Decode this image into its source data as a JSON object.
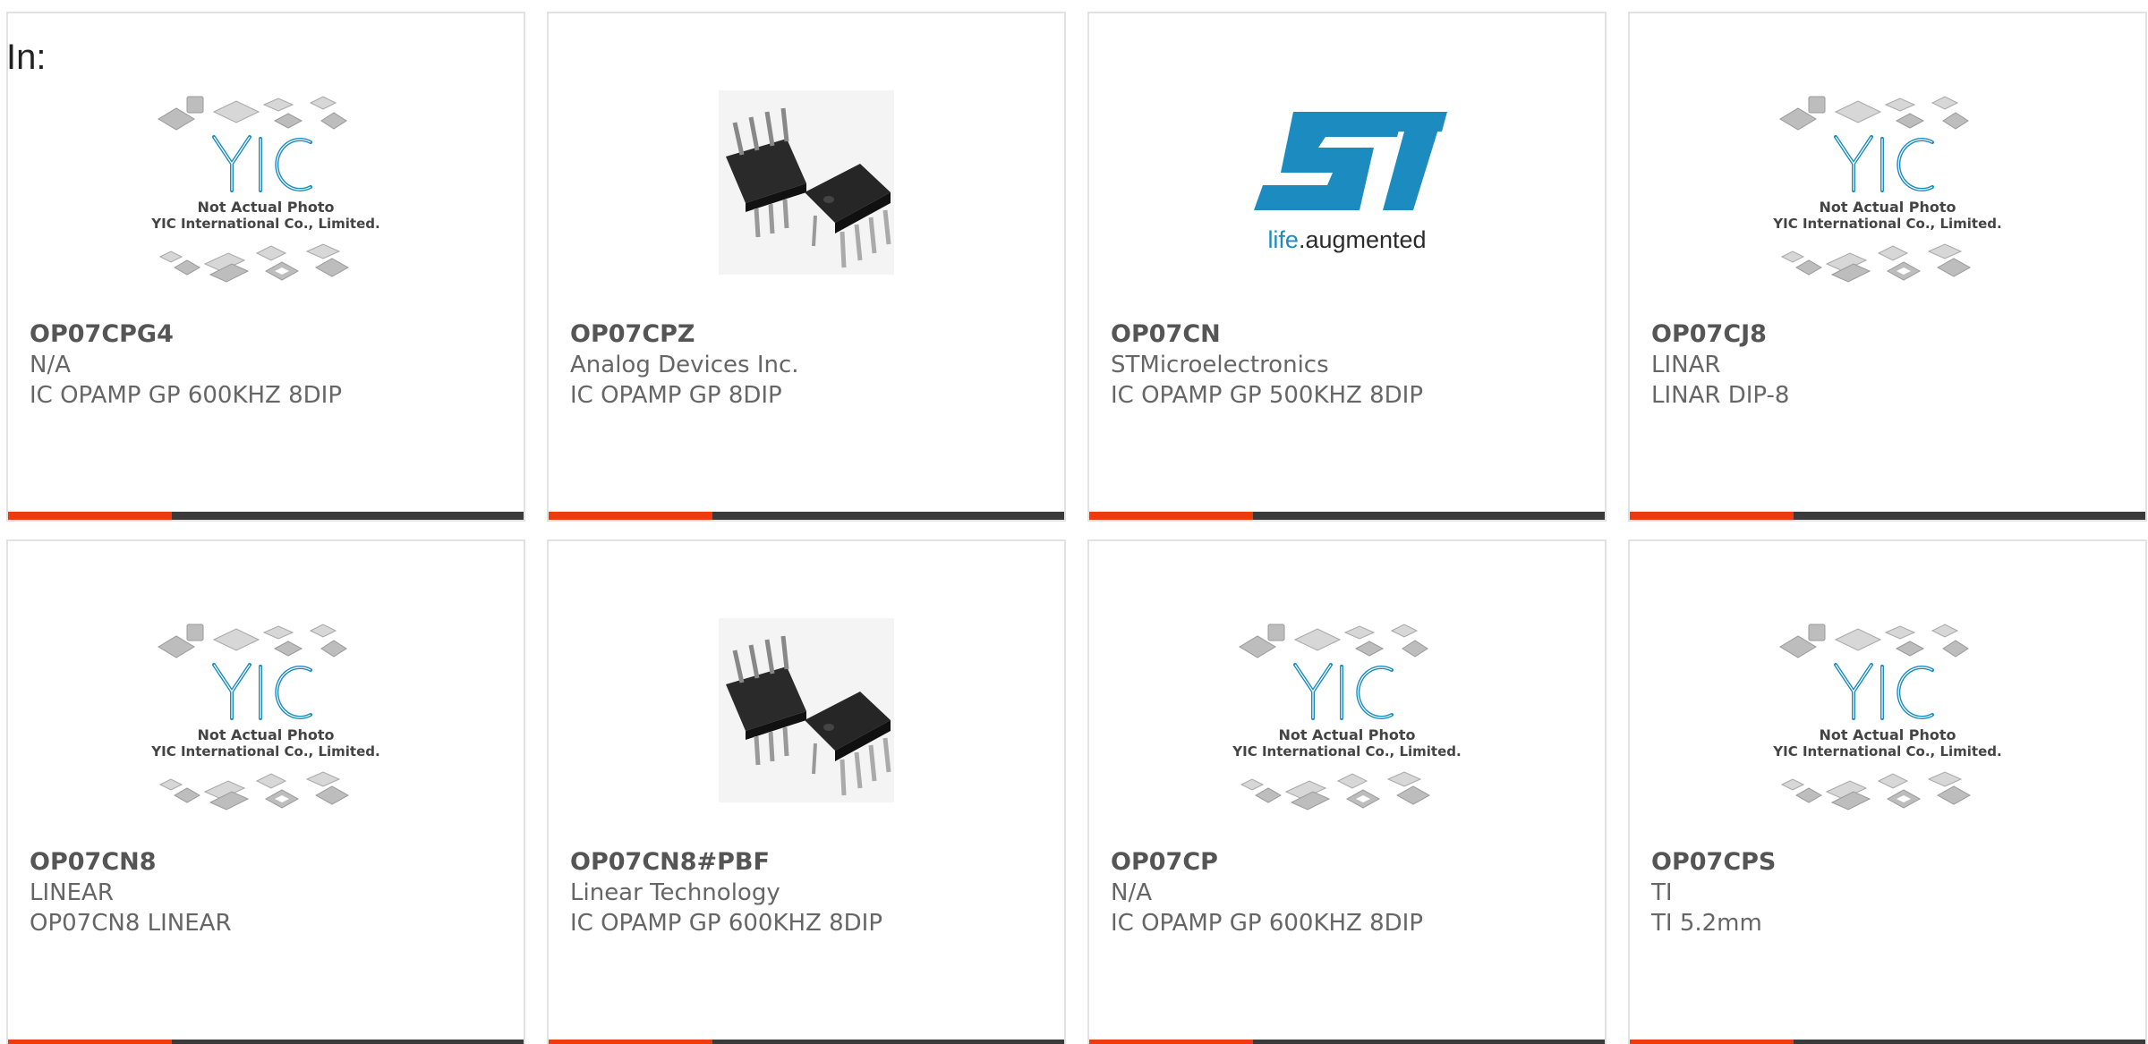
{
  "header": {
    "label": "In:"
  },
  "brand": {
    "yic_logo_text": "YIC",
    "placeholder_line1": "Not Actual Photo",
    "placeholder_line2": "YIC International Co., Limited.",
    "st_logo_text": "ST",
    "st_tagline_part1": "life",
    "st_tagline_part2": ".augmented",
    "accent_color": "#ee3a0f",
    "bar_color": "#3a3a3a",
    "st_blue": "#1c8cc0"
  },
  "products": [
    {
      "part": "OP07CPG4",
      "manufacturer": "N/A",
      "description": "IC OPAMP GP 600KHZ 8DIP",
      "image": "yic-placeholder"
    },
    {
      "part": "OP07CPZ",
      "manufacturer": "Analog Devices Inc.",
      "description": "IC OPAMP GP 8DIP",
      "image": "dip8-chip-photo"
    },
    {
      "part": "OP07CN",
      "manufacturer": "STMicroelectronics",
      "description": "IC OPAMP GP 500KHZ 8DIP",
      "image": "st-logo"
    },
    {
      "part": "OP07CJ8",
      "manufacturer": "LINAR",
      "description": "LINAR DIP-8",
      "image": "yic-placeholder"
    },
    {
      "part": "OP07CN8",
      "manufacturer": "LINEAR",
      "description": "OP07CN8 LINEAR",
      "image": "yic-placeholder"
    },
    {
      "part": "OP07CN8#PBF",
      "manufacturer": "Linear Technology",
      "description": "IC OPAMP GP 600KHZ 8DIP",
      "image": "dip8-chip-photo"
    },
    {
      "part": "OP07CP",
      "manufacturer": "N/A",
      "description": "IC OPAMP GP 600KHZ 8DIP",
      "image": "yic-placeholder"
    },
    {
      "part": "OP07CPS",
      "manufacturer": "TI",
      "description": "TI 5.2mm",
      "image": "yic-placeholder"
    }
  ]
}
